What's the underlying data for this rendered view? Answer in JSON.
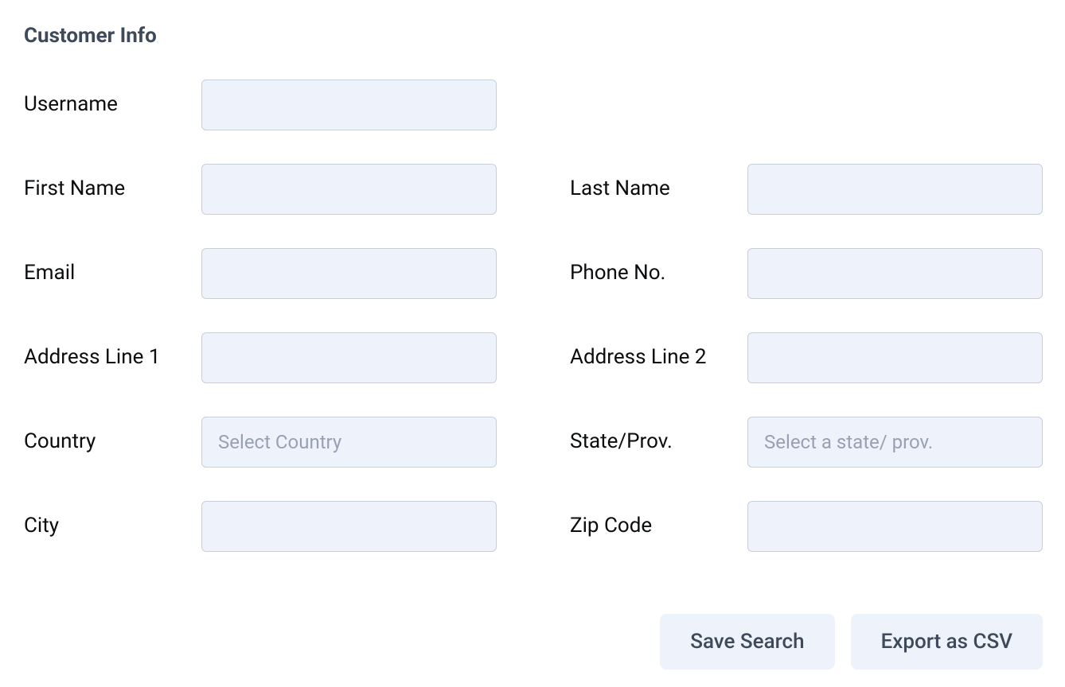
{
  "section": {
    "title": "Customer Info"
  },
  "fields": {
    "username": {
      "label": "Username",
      "value": "",
      "placeholder": ""
    },
    "first_name": {
      "label": "First Name",
      "value": "",
      "placeholder": ""
    },
    "last_name": {
      "label": "Last Name",
      "value": "",
      "placeholder": ""
    },
    "email": {
      "label": "Email",
      "value": "",
      "placeholder": ""
    },
    "phone": {
      "label": "Phone No.",
      "value": "",
      "placeholder": ""
    },
    "address1": {
      "label": "Address Line 1",
      "value": "",
      "placeholder": ""
    },
    "address2": {
      "label": "Address Line 2",
      "value": "",
      "placeholder": ""
    },
    "country": {
      "label": "Country",
      "value": "",
      "placeholder": "Select Country"
    },
    "state": {
      "label": "State/Prov.",
      "value": "",
      "placeholder": "Select a state/ prov."
    },
    "city": {
      "label": "City",
      "value": "",
      "placeholder": ""
    },
    "zip": {
      "label": "Zip Code",
      "value": "",
      "placeholder": ""
    }
  },
  "buttons": {
    "save_search": "Save Search",
    "export_csv": "Export as CSV"
  }
}
